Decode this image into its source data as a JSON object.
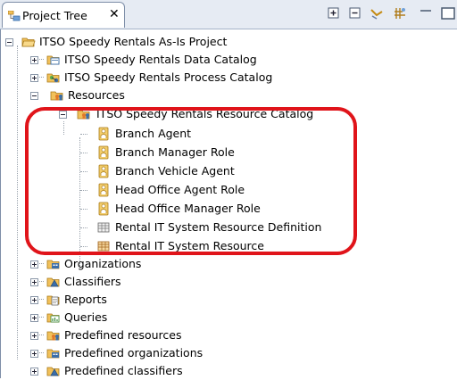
{
  "view": {
    "tab_label": "Project Tree",
    "close_glyph": "✕"
  },
  "toolbar": {
    "icons": [
      "expand-all-icon",
      "collapse-all-icon",
      "link-editor-icon",
      "filter-icon",
      "minimize-icon"
    ]
  },
  "tree": {
    "project": "ITSO Speedy Rentals As-Is Project",
    "data_catalog": "ITSO Speedy Rentals Data Catalog",
    "process_catalog": "ITSO Speedy Rentals Process Catalog",
    "resources": "Resources",
    "resource_catalog": "ITSO Speedy Rentals Resource Catalog",
    "roles": [
      "Branch Agent",
      "Branch Manager Role",
      "Branch Vehicle Agent",
      "Head Office Agent Role",
      "Head Office Manager Role"
    ],
    "resource_definition": "Rental IT System Resource Definition",
    "resource": "Rental IT System Resource",
    "organizations": "Organizations",
    "classifiers": "Classifiers",
    "reports": "Reports",
    "queries": "Queries",
    "predefined_resources": "Predefined resources",
    "predefined_organizations": "Predefined organizations",
    "predefined_classifiers": "Predefined classifiers"
  },
  "colors": {
    "highlight": "#e0141a",
    "folder": "#f2c15a",
    "role": "#e8b84a"
  }
}
